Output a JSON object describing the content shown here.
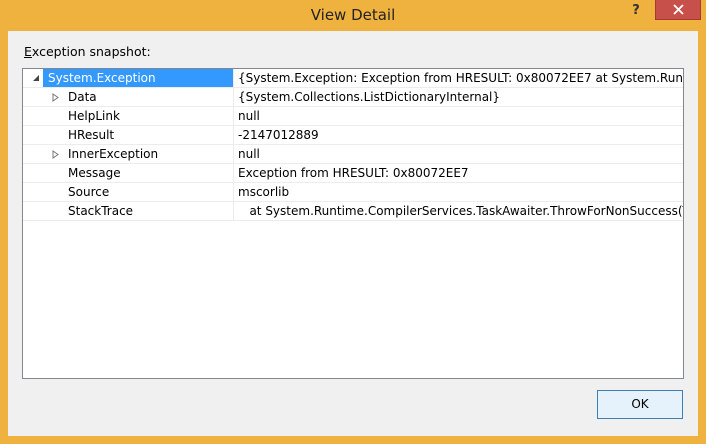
{
  "window": {
    "title": "View Detail",
    "help_label": "?",
    "close_icon": "close-icon"
  },
  "snapshot_label_prefix": "E",
  "snapshot_label_rest": "xception snapshot:",
  "rows": [
    {
      "name": "System.Exception",
      "value": "{System.Exception: Exception from HRESULT: 0x80072EE7    at System.Runtime.CompilerServices.TaskAwaiter.ThrowForNonSuccess(Task task)",
      "expander": "expanded"
    },
    {
      "name": "Data",
      "value": "{System.Collections.ListDictionaryInternal}",
      "expander": "collapsed"
    },
    {
      "name": "HelpLink",
      "value": "null",
      "expander": "none"
    },
    {
      "name": "HResult",
      "value": "-2147012889",
      "expander": "none"
    },
    {
      "name": "InnerException",
      "value": "null",
      "expander": "collapsed"
    },
    {
      "name": "Message",
      "value": "Exception from HRESULT: 0x80072EE7",
      "expander": "none"
    },
    {
      "name": "Source",
      "value": "mscorlib",
      "expander": "none"
    },
    {
      "name": "StackTrace",
      "value": "   at System.Runtime.CompilerServices.TaskAwaiter.ThrowForNonSuccess(Task task)",
      "expander": "none"
    }
  ],
  "buttons": {
    "ok_label": "OK"
  },
  "colors": {
    "titlebar": "#f0b23f",
    "selection": "#3399ff",
    "close_button": "#c7504a"
  }
}
